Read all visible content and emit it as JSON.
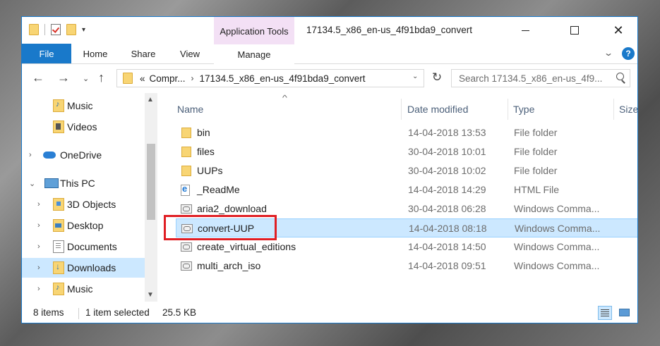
{
  "window": {
    "title": "17134.5_x86_en-us_4f91bda9_convert",
    "context_tab_group": "Application Tools",
    "qat_dropdown": "▾"
  },
  "ribbon": {
    "tabs": [
      "File",
      "Home",
      "Share",
      "View",
      "Manage"
    ],
    "help": "?",
    "collapse": "⌄"
  },
  "address": {
    "prefix": "«",
    "crumbs": [
      "Compr...",
      "17134.5_x86_en-us_4f91bda9_convert"
    ],
    "separator": "›",
    "search_placeholder": "Search 17134.5_x86_en-us_4f9..."
  },
  "nav": {
    "back": "←",
    "forward": "→",
    "recent": "⌄",
    "up": "↑",
    "refresh": "↻",
    "items": [
      {
        "label": "Music",
        "icon": "music-folder-icon",
        "chevron": ""
      },
      {
        "label": "Videos",
        "icon": "videos-folder-icon",
        "chevron": ""
      },
      {
        "label": "OneDrive",
        "icon": "onedrive-icon",
        "chevron": "›"
      },
      {
        "label": "This PC",
        "icon": "this-pc-icon",
        "chevron": "⌄"
      },
      {
        "label": "3D Objects",
        "icon": "3d-objects-icon",
        "chevron": "›"
      },
      {
        "label": "Desktop",
        "icon": "desktop-folder-icon",
        "chevron": "›"
      },
      {
        "label": "Documents",
        "icon": "documents-folder-icon",
        "chevron": "›"
      },
      {
        "label": "Downloads",
        "icon": "downloads-folder-icon",
        "chevron": "›"
      },
      {
        "label": "Music",
        "icon": "music-folder-icon",
        "chevron": "›"
      }
    ],
    "selected_item": "Downloads",
    "scroll_up": "▲",
    "scroll_down": "▼"
  },
  "columns": {
    "name": "Name",
    "date": "Date modified",
    "type": "Type",
    "size": "Size",
    "sort": "^"
  },
  "files": [
    {
      "name": "bin",
      "date": "14-04-2018 13:53",
      "type": "File folder",
      "icon": "folder-icon"
    },
    {
      "name": "files",
      "date": "30-04-2018 10:01",
      "type": "File folder",
      "icon": "folder-icon"
    },
    {
      "name": "UUPs",
      "date": "30-04-2018 10:02",
      "type": "File folder",
      "icon": "folder-icon"
    },
    {
      "name": "_ReadMe",
      "date": "14-04-2018 14:29",
      "type": "HTML File",
      "icon": "html-file-icon"
    },
    {
      "name": "aria2_download",
      "date": "30-04-2018 06:28",
      "type": "Windows Comma...",
      "icon": "cmd-script-icon"
    },
    {
      "name": "convert-UUP",
      "date": "14-04-2018 08:18",
      "type": "Windows Comma...",
      "icon": "cmd-script-icon"
    },
    {
      "name": "create_virtual_editions",
      "date": "14-04-2018 14:50",
      "type": "Windows Comma...",
      "icon": "cmd-script-icon"
    },
    {
      "name": "multi_arch_iso",
      "date": "14-04-2018 09:51",
      "type": "Windows Comma...",
      "icon": "cmd-script-icon"
    }
  ],
  "selected_file": "convert-UUP",
  "highlight_color": "#e01e24",
  "accent_color": "#1979ca",
  "status": {
    "count": "8 items",
    "selection": "1 item selected",
    "size": "25.5 KB"
  }
}
